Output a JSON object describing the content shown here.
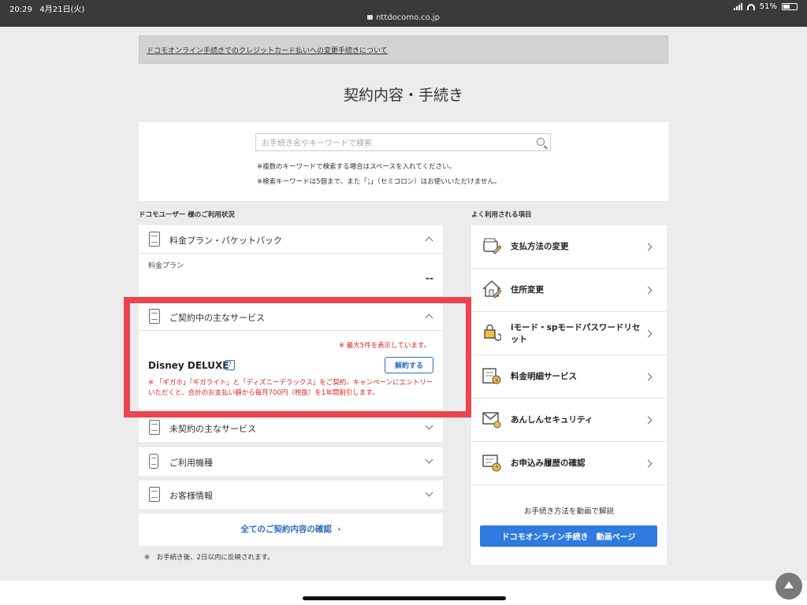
{
  "status_bar": {
    "time": "20:29",
    "date": "4月21日(火)",
    "url": "nttdocomo.co.jp",
    "battery": "51%",
    "battery_level": 0.51
  },
  "notice": {
    "link": "ドコモオンライン手続きでのクレジットカード払いへの変更手続きについて"
  },
  "page_title": "契約内容・手続き",
  "search": {
    "placeholder": "お手続き名やキーワードで検索",
    "note1": "※複数のキーワードで検索する場合はスペースを入れてください。",
    "note2": "※検索キーワードは5個まで、また「；」（セミコロン）はお使いいただけません。"
  },
  "left": {
    "section_title": "ドコモユーザー 様のご利用状況",
    "plan": {
      "title": "料金プラン・パケットパック",
      "label": "料金プラン",
      "value": "--"
    },
    "services": {
      "title": "ご契約中の主なサービス",
      "max_note": "※ 最大5件を表示しています。",
      "name": "Disney DELUXE",
      "help": "?",
      "cancel": "解約する",
      "campaign": "※ 「ギガホ」「ギガライト」と「ディズニーデラックス」をご契約、キャンペーンにエントリーいただくと、合計のお支払い額から毎月700円（税抜）を1年間割引します。"
    },
    "unsubscribed": "未契約の主なサービス",
    "devices": "ご利用機種",
    "customer": "お客様情報",
    "confirm_all": "全てのご契約内容の確認",
    "footnote": "※　お手続き後、2日以内に反映されます。"
  },
  "right": {
    "section_title": "よく利用される項目",
    "items": [
      {
        "label": "支払方法の変更",
        "icon": "wallet-icon"
      },
      {
        "label": "住所変更",
        "icon": "house-icon"
      },
      {
        "label": "iモード・spモードパスワードリセット",
        "icon": "lock-reset-icon"
      },
      {
        "label": "料金明細サービス",
        "icon": "bill-icon"
      },
      {
        "label": "あんしんセキュリティ",
        "icon": "mail-shield-icon"
      },
      {
        "label": "お申込み履歴の確認",
        "icon": "history-icon"
      }
    ],
    "video_note": "お手続き方法を動画で解説",
    "video_button": "ドコモオンライン手続き　動画ページ"
  },
  "colors": {
    "accent": "#2f7be0",
    "highlight": "#e84551",
    "alert": "#dd2222"
  }
}
